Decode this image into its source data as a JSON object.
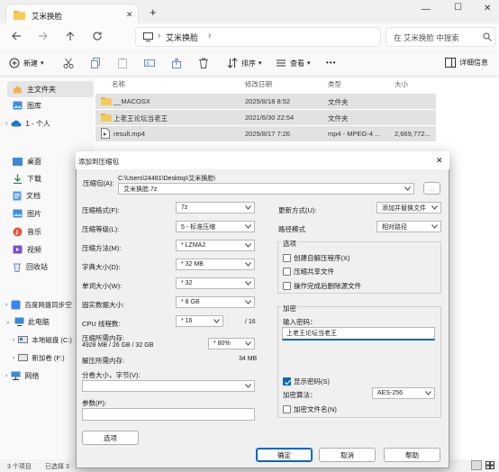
{
  "window": {
    "tab_title": "艾米换脸",
    "new_tab_symbol": "+",
    "minimize": "—",
    "maximize": "☐",
    "close": "✕"
  },
  "address": {
    "segment_sep": "›",
    "current_folder": "艾米换脸",
    "search_placeholder": "在 艾米换脸 中搜索"
  },
  "toolbar": {
    "new_label": "新建",
    "new_caret": "▾",
    "sort_label": "排序",
    "view_label": "查看",
    "more_label": "•••",
    "details_label": "详细信息"
  },
  "nav": {
    "items": [
      {
        "label": "主文件夹"
      },
      {
        "label": "图库"
      },
      {
        "label": "1 - 个人"
      },
      {
        "label": "桌面"
      },
      {
        "label": "下载"
      },
      {
        "label": "文档"
      },
      {
        "label": "图片"
      },
      {
        "label": "音乐"
      },
      {
        "label": "视频"
      },
      {
        "label": "回收站"
      },
      {
        "label": "百度网盘同步空"
      },
      {
        "label": "此电脑"
      },
      {
        "label": "本地磁盘 (C:)"
      },
      {
        "label": "新加卷 (F:)"
      },
      {
        "label": "网络"
      }
    ]
  },
  "files": {
    "columns": [
      "名称",
      "修改日期",
      "类型",
      "大小"
    ],
    "rows": [
      {
        "name": "__MACOSX",
        "date": "2025/8/18 8:52",
        "type": "文件夹",
        "size": ""
      },
      {
        "name": "上老王论坛当老王",
        "date": "2021/6/30 22:54",
        "type": "文件夹",
        "size": ""
      },
      {
        "name": "result.mp4",
        "date": "2025/8/17 7:26",
        "type": "mp4 - MPEG-4 ...",
        "size": "2,669,772..."
      }
    ]
  },
  "status": {
    "count": "3 个项目",
    "selected": "已选择 3"
  },
  "dialog": {
    "title": "添加到压缩包",
    "close": "✕",
    "archive_label": "压缩包(A):",
    "archive_path": "C:\\Users\\24481\\Desktop\\艾米换脸\\",
    "archive_name": "艾米换脸.7z",
    "browse": "...",
    "format_label": "压缩格式(F):",
    "format_value": "7z",
    "level_label": "压缩等级(L):",
    "level_value": "5 - 标准压缩",
    "method_label": "压缩方法(M):",
    "method_value": "* LZMA2",
    "dict_label": "字典大小(D):",
    "dict_value": "* 32 MB",
    "word_label": "单词大小(W):",
    "word_value": "* 32",
    "solid_label": "固实数据大小:",
    "solid_value": "* 8 GB",
    "threads_label": "CPU 线程数:",
    "threads_value": "* 16",
    "threads_total": "/ 16",
    "mem_comp_label": "压缩所需内存:",
    "mem_comp_value": "4928 MB / 26 GB / 32 GB",
    "mem_pct_value": "* 80%",
    "mem_decomp_label": "解压所需内存:",
    "mem_decomp_value": "34 MB",
    "split_label": "分卷大小，字节(V):",
    "params_label": "参数(P):",
    "options_btn": "选项",
    "update_label": "更新方式(U):",
    "update_value": "添加并替换文件",
    "pathmode_label": "路径模式",
    "pathmode_value": "相对路径",
    "opts_group_title": "选项",
    "opt_sfx": "创建自解压程序(X)",
    "opt_shared": "压缩共享文件",
    "opt_delete": "操作完成后删除源文件",
    "enc_group_title": "加密",
    "pwd_label": "输入密码：",
    "pwd_value": "上老王论坛当老王",
    "show_pwd": "显示密码(S)",
    "enc_method_label": "加密算法：",
    "enc_method_value": "AES-256",
    "enc_names": "加密文件名(N)",
    "ok": "确定",
    "cancel": "取消",
    "help": "帮助"
  }
}
